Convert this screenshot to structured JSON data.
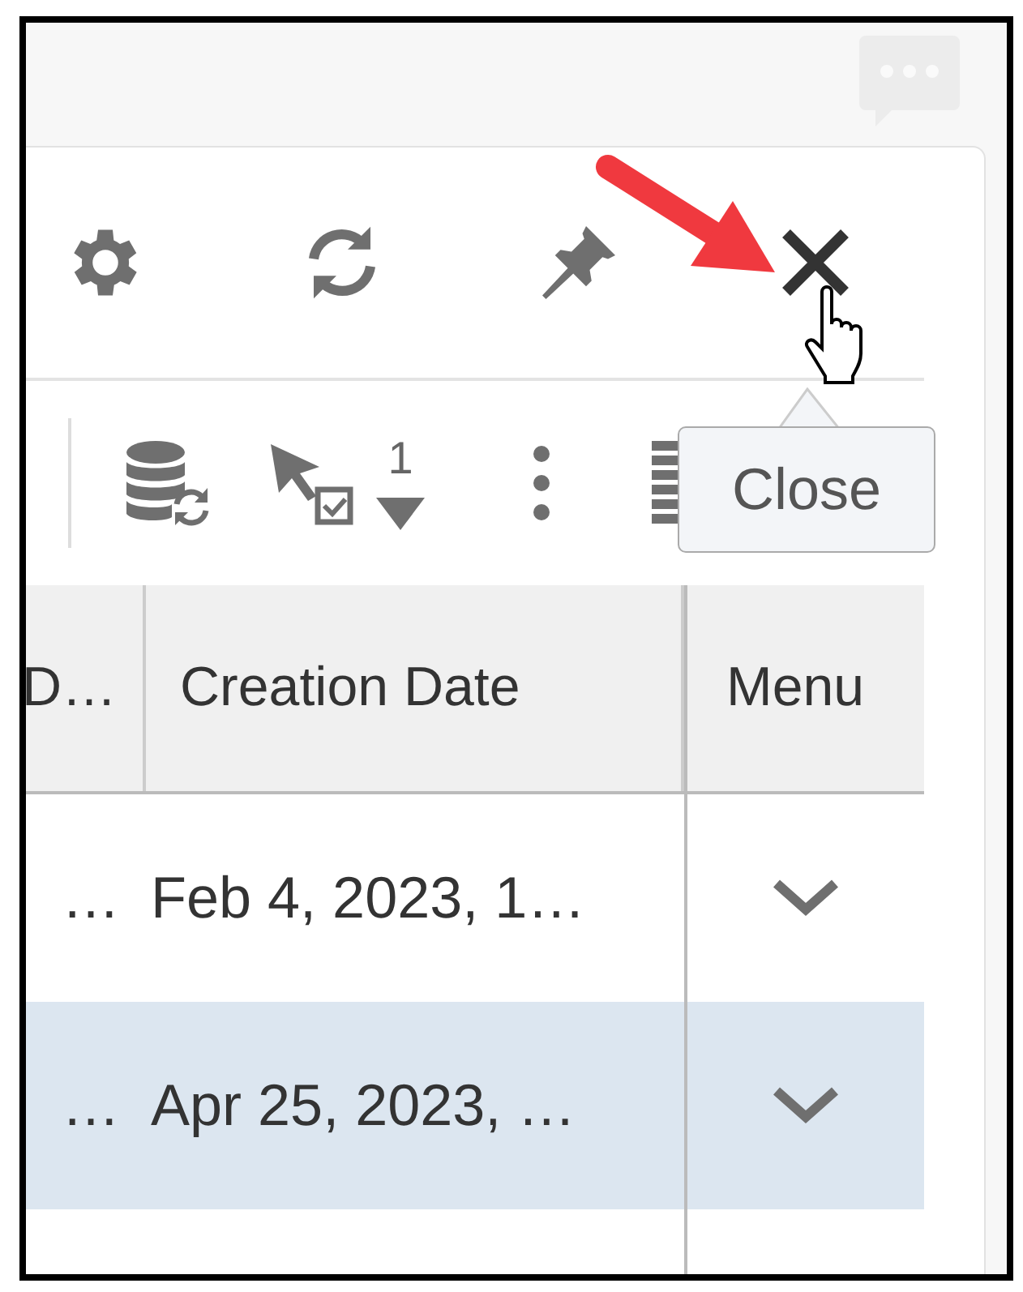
{
  "toolbar": {
    "selection_count": "1"
  },
  "tooltip": {
    "text": "Close"
  },
  "table": {
    "columns": [
      "D…",
      "Creation Date",
      "Menu"
    ],
    "rows": [
      {
        "selected": false,
        "cells": [
          "…",
          "Feb 4, 2023, 1…"
        ]
      },
      {
        "selected": true,
        "cells": [
          "…",
          "Apr 25, 2023, …"
        ]
      }
    ]
  }
}
